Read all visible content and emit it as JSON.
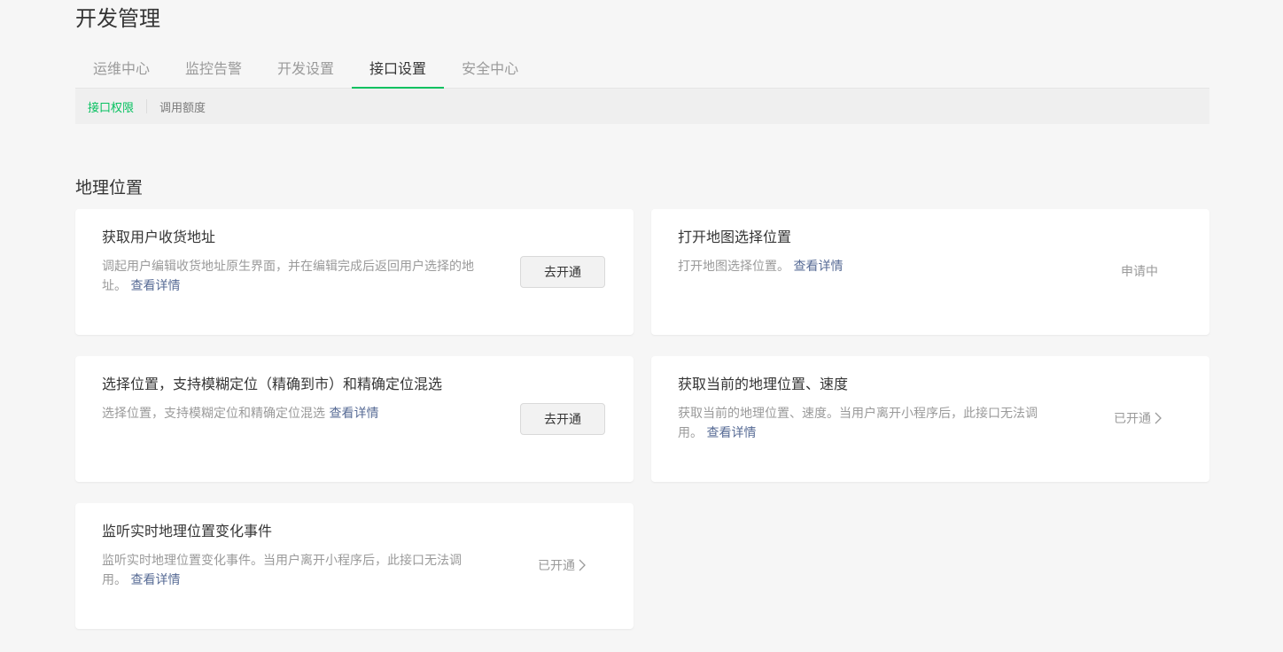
{
  "page": {
    "title": "开发管理"
  },
  "tabs": [
    {
      "label": "运维中心"
    },
    {
      "label": "监控告警"
    },
    {
      "label": "开发设置"
    },
    {
      "label": "接口设置",
      "active": true
    },
    {
      "label": "安全中心"
    }
  ],
  "subnav": [
    {
      "label": "接口权限",
      "active": true
    },
    {
      "label": "调用额度"
    }
  ],
  "section": {
    "title": "地理位置"
  },
  "link_text": "查看详情",
  "cards": [
    {
      "title": "获取用户收货地址",
      "desc": "调起用户编辑收货地址原生界面，并在编辑完成后返回用户选择的地址。",
      "link": "查看详情",
      "action": "去开通"
    },
    {
      "title": "打开地图选择位置",
      "desc": "打开地图选择位置。",
      "link": "查看详情",
      "status": "申请中"
    },
    {
      "title": "选择位置，支持模糊定位（精确到市）和精确定位混选",
      "desc": "选择位置，支持模糊定位和精确定位混选",
      "link": "查看详情",
      "action": "去开通"
    },
    {
      "title": "获取当前的地理位置、速度",
      "desc": "获取当前的地理位置、速度。当用户离开小程序后，此接口无法调用。",
      "link": "查看详情",
      "status": "已开通"
    },
    {
      "title": "监听实时地理位置变化事件",
      "desc": "监听实时地理位置变化事件。当用户离开小程序后，此接口无法调用。",
      "link": "查看详情",
      "status": "已开通"
    }
  ],
  "colors": {
    "accent": "#07c160",
    "link": "#576b95",
    "muted_text": "#9a9a9a",
    "background": "#f6f6f6"
  }
}
